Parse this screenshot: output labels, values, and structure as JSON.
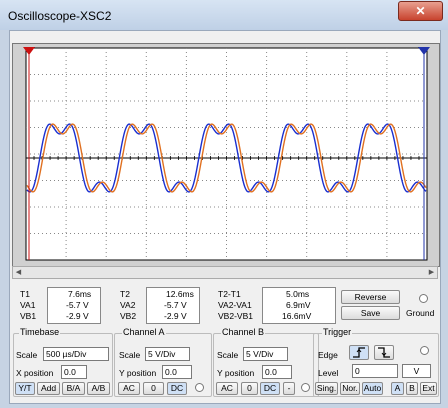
{
  "window": {
    "title": "Oscilloscope-XSC2",
    "close": "✕"
  },
  "readout": {
    "t1": {
      "label": "T1",
      "time": "7.6ms",
      "va_label": "VA1",
      "va": "-5.7 V",
      "vb_label": "VB1",
      "vb": "-2.9 V"
    },
    "t2": {
      "label": "T2",
      "time": "12.6ms",
      "va_label": "VA2",
      "va": "-5.7 V",
      "vb_label": "VB2",
      "vb": "-2.9 V"
    },
    "delta": {
      "label": "T2-T1",
      "time": "5.0ms",
      "va_label": "VA2-VA1",
      "va": "6.9mV",
      "vb_label": "VB2-VB1",
      "vb": "16.6mV"
    }
  },
  "buttons": {
    "reverse": "Reverse",
    "save": "Save",
    "ground": "Ground"
  },
  "timebase": {
    "title": "Timebase",
    "scale_label": "Scale",
    "scale": "500 µs/Div",
    "xpos_label": "X position",
    "xpos": "0.0",
    "modes": [
      "Y/T",
      "Add",
      "B/A",
      "A/B"
    ]
  },
  "channel_a": {
    "title": "Channel A",
    "scale_label": "Scale",
    "scale": "5 V/Div",
    "ypos_label": "Y position",
    "ypos": "0.0",
    "coupling": [
      "AC",
      "0",
      "DC"
    ]
  },
  "channel_b": {
    "title": "Channel B",
    "scale_label": "Scale",
    "scale": "5 V/Div",
    "ypos_label": "Y position",
    "ypos": "0.0",
    "coupling": [
      "AC",
      "0",
      "DC",
      "-"
    ]
  },
  "trigger": {
    "title": "Trigger",
    "edge_label": "Edge",
    "level_label": "Level",
    "level": "0",
    "unit": "V",
    "modes": [
      "Sing.",
      "Nor.",
      "Auto"
    ],
    "sources": [
      "A",
      "B",
      "Ext"
    ]
  },
  "colors": {
    "channel_a": "#e07020",
    "channel_b": "#1a2fd0",
    "cursor_1": "#cc1111",
    "cursor_2": "#2233aa"
  }
}
